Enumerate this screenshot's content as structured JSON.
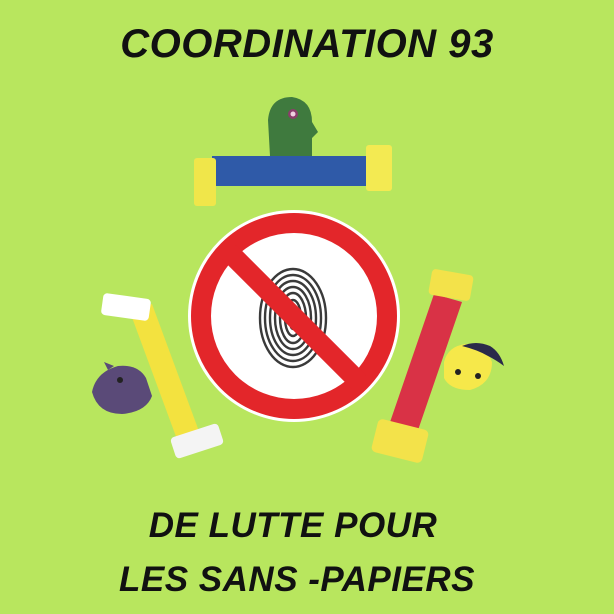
{
  "header": {
    "title": "COORDINATION 93"
  },
  "footer": {
    "line1": "DE LUTTE POUR",
    "line2": "LES SANS -PAPIERS"
  },
  "emblem": {
    "center_icon": "no-fingerprint-prohibition-icon",
    "figures": [
      "green-figure-icon",
      "purple-figure-icon",
      "yellow-face-figure-icon"
    ]
  },
  "colors": {
    "background": "#b8e65e",
    "prohibition_red": "#e3262a",
    "text": "#111111"
  }
}
